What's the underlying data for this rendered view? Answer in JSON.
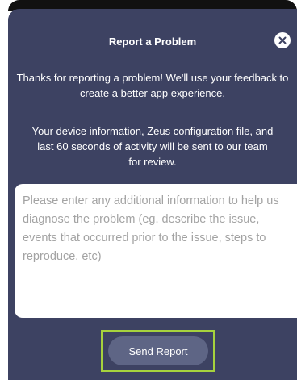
{
  "dialog": {
    "title": "Report a Problem",
    "close_icon": "close-circle-icon",
    "intro_text": "Thanks for reporting a problem! We'll use your feedback to create a better app experience.",
    "device_info_lines": [
      "Your device information, Zeus configuration file, and",
      "last 60 seconds of activity will be sent to our team",
      "for review."
    ],
    "details_input": {
      "value": "",
      "placeholder": "Please enter any additional information to help us diagnose the problem (eg. describe the issue, events that occurred prior to the issue, steps to reproduce, etc)"
    },
    "send_button_label": "Send Report"
  },
  "colors": {
    "dialog_background": "#3d4262",
    "button_background": "#5e6585",
    "highlight_outline": "#a6d23d",
    "input_background": "#ffffff"
  }
}
